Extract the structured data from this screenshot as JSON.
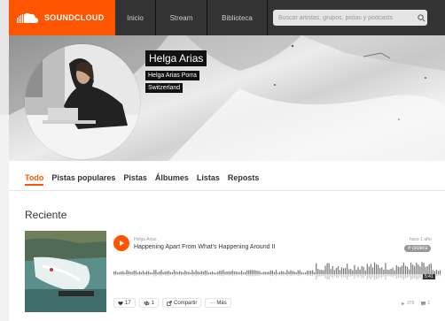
{
  "header": {
    "logo_text": "SOUNDCLOUD",
    "nav": {
      "inicio": "Inicio",
      "stream": "Stream",
      "biblioteca": "Biblioteca"
    },
    "search_placeholder": "Buscar artistas, grupos, pistas y podcasts"
  },
  "profile": {
    "username": "Helga Arias",
    "full_name": "Helga Arias Porra",
    "country": "Switzerland"
  },
  "tabs": [
    "Todo",
    "Pistas populares",
    "Pistas",
    "Álbumes",
    "Listas",
    "Reposts"
  ],
  "active_tab": "Todo",
  "section_title": "Reciente",
  "track": {
    "user": "Helga Arias",
    "title": "Happening Apart From What's Happening Around II",
    "posted": "hace 1 año",
    "tag": "# ciclera",
    "duration": "5:41",
    "likes": "17",
    "reposts": "1",
    "share_label": "Compartir",
    "more_label": "Más",
    "plays": "379",
    "comments": "1"
  },
  "colors": {
    "accent": "#ff5500",
    "header_bg": "#333333"
  }
}
